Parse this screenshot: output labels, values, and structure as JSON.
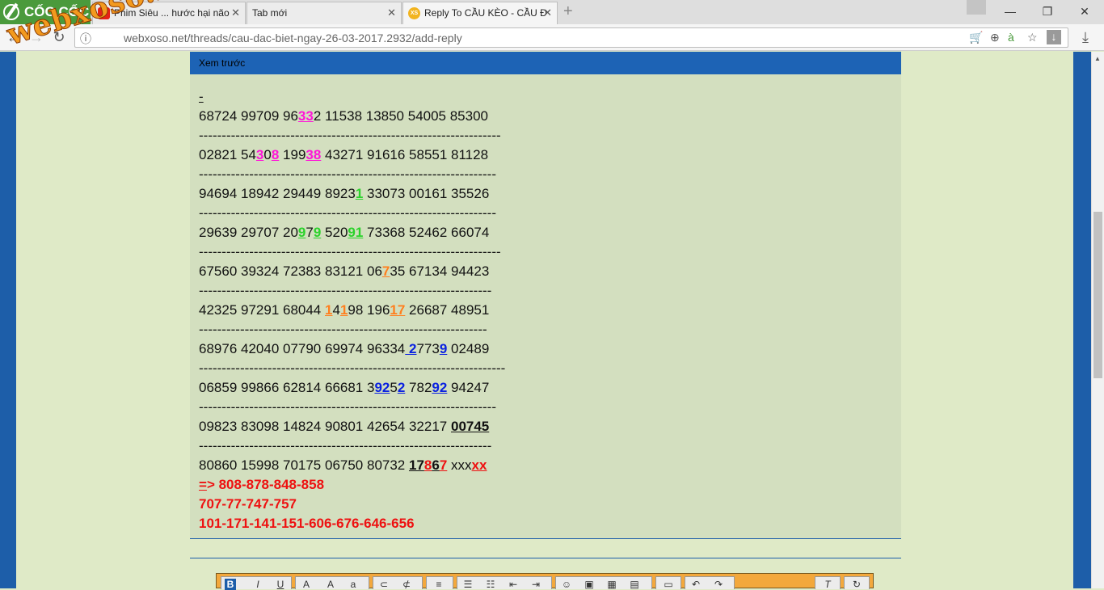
{
  "browser": {
    "brand": "CỐC CỐC",
    "tabs": [
      {
        "title": "Phim Siêu ... hước hại não",
        "active": false,
        "icon": "youtube-icon",
        "icon_color": "#e62117"
      },
      {
        "title": "Tab mới",
        "active": false
      },
      {
        "title": "Reply To CẦU KÈO - CẦU Đ",
        "active": true,
        "icon": "xs-favicon",
        "icon_color": "#f2b41f",
        "icon_text": "XS"
      }
    ],
    "url": "webxoso.net/threads/cau-dac-biet-ngay-26-03-2017.2932/add-reply"
  },
  "watermark": "webxoso.net",
  "preview": {
    "header": "Xem trước"
  },
  "toolbar": {
    "groups": [
      "text-format",
      "font",
      "links",
      "align",
      "lists",
      "media",
      "source",
      "undo-redo",
      "spacer",
      "italic-remove",
      "expand"
    ]
  }
}
